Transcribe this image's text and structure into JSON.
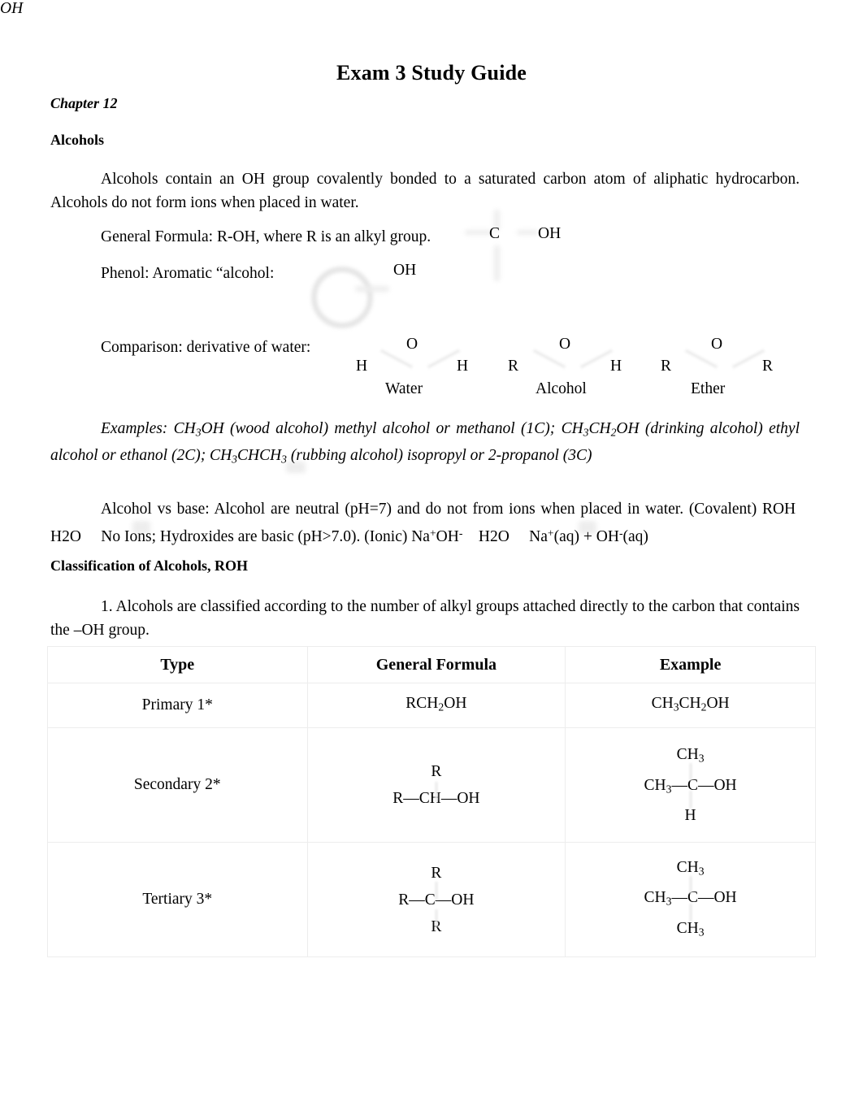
{
  "document": {
    "title": "Exam 3 Study Guide",
    "chapter": "Chapter 12"
  },
  "sections": {
    "alcohols_heading": "Alcohols",
    "classification_heading": "Classification of Alcohols, ROH"
  },
  "paragraphs": {
    "intro": "Alcohols contain an OH group covalently bonded to a saturated carbon atom of aliphatic hydrocarbon. Alcohols do not form ions when placed in water.",
    "general_formula": "General Formula: R-OH, where R is an alkyl group.",
    "phenol": "Phenol: Aromatic “alcohol:",
    "comparison": "Comparison: derivative of water:",
    "examples_line1": "Examples: CH3OH (wood alcohol) methyl alcohol or methanol (1C); CH3CH2OH (drinking alcohol)",
    "examples_line2": "ethyl alcohol or ethanol (2C); CH3CHCH3 (rubbing alcohol) isopropyl or 2-propanol (3C)",
    "examples_oh": "OH",
    "vs_base_line1": "Alcohol vs base: Alcohol are neutral (pH=7) and do not from ions when placed in water. (Covalent)",
    "vs_base_line2": "ROH  H2O    No Ions; Hydroxides are basic (pH>7.0). (Ionic) Na+OH-    H2O    Na+(aq) + OH-(aq)",
    "numbered_1": "1. Alcohols are classified according to the number of alkyl groups attached directly to the carbon that contains the –OH group."
  },
  "general_formula_structure": {
    "carbon": "C",
    "hydroxyl": "OH"
  },
  "phenol_structure": {
    "hydroxyl": "OH"
  },
  "water_comparison": {
    "molecules": [
      {
        "name": "Water",
        "center": "O",
        "left": "H",
        "right": "H"
      },
      {
        "name": "Alcohol",
        "center": "O",
        "left": "R",
        "right": "H"
      },
      {
        "name": "Ether",
        "center": "O",
        "left": "R",
        "right": "R"
      }
    ]
  },
  "classification_table": {
    "headers": [
      "Type",
      "General Formula",
      "Example"
    ],
    "rows": [
      {
        "type": "Primary 1*",
        "formula": {
          "top": "",
          "mid": "RCH2OH",
          "bottom": ""
        },
        "example": {
          "top": "",
          "mid": "CH3CH2OH",
          "bottom": ""
        }
      },
      {
        "type": "Secondary 2*",
        "formula": {
          "top": "R",
          "mid": "R—CH—OH",
          "bottom": ""
        },
        "example": {
          "top": "CH3",
          "mid": "CH3—C—OH",
          "bottom": "H"
        }
      },
      {
        "type": "Tertiary 3*",
        "formula": {
          "top": "R",
          "mid": "R—C—OH",
          "bottom": "R"
        },
        "example": {
          "top": "CH3",
          "mid": "CH3—C—OH",
          "bottom": "CH3"
        }
      }
    ]
  }
}
